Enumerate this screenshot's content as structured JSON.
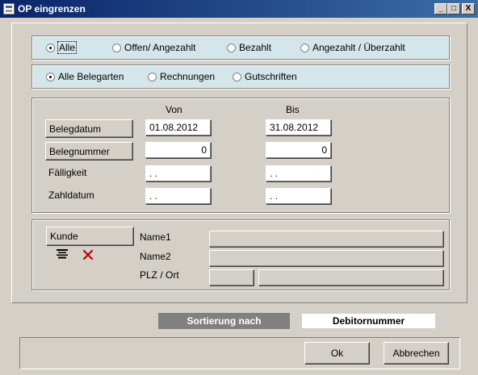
{
  "window": {
    "title": "OP eingrenzen",
    "controls": [
      "_",
      "□",
      "X"
    ]
  },
  "filter_status": {
    "options": [
      "Alle",
      "Offen/ Angezahlt",
      "Bezahlt",
      "Angezahlt / Überzahlt"
    ],
    "selected": "Alle"
  },
  "filter_belegart": {
    "options": [
      "Alle Belegarten",
      "Rechnungen",
      "Gutschriften"
    ],
    "selected": "Alle Belegarten"
  },
  "range": {
    "from_header": "Von",
    "to_header": "Bis",
    "rows": [
      {
        "label": "Belegdatum",
        "from": "01.08.2012",
        "to": "31.08.2012"
      },
      {
        "label": "Belegnummer",
        "from": "0",
        "to": "0"
      },
      {
        "label": "Fälligkeit",
        "from": ". .",
        "to": ". ."
      },
      {
        "label": "Zahldatum",
        "from": ". .",
        "to": ". ."
      }
    ]
  },
  "customer": {
    "button": "Kunde",
    "name1_label": "Name1",
    "name2_label": "Name2",
    "plz_ort_label": "PLZ / Ort",
    "name1": "",
    "name2": "",
    "plz": "",
    "ort": ""
  },
  "sort": {
    "label": "Sortierung nach",
    "value": "Debitornummer"
  },
  "footer": {
    "ok": "Ok",
    "cancel": "Abbrechen"
  },
  "colors": {
    "titlebar": "#0a246a",
    "radio_panel": "#d5e6ea",
    "sort_label_bg": "#808080",
    "delete_icon": "#c00000"
  }
}
